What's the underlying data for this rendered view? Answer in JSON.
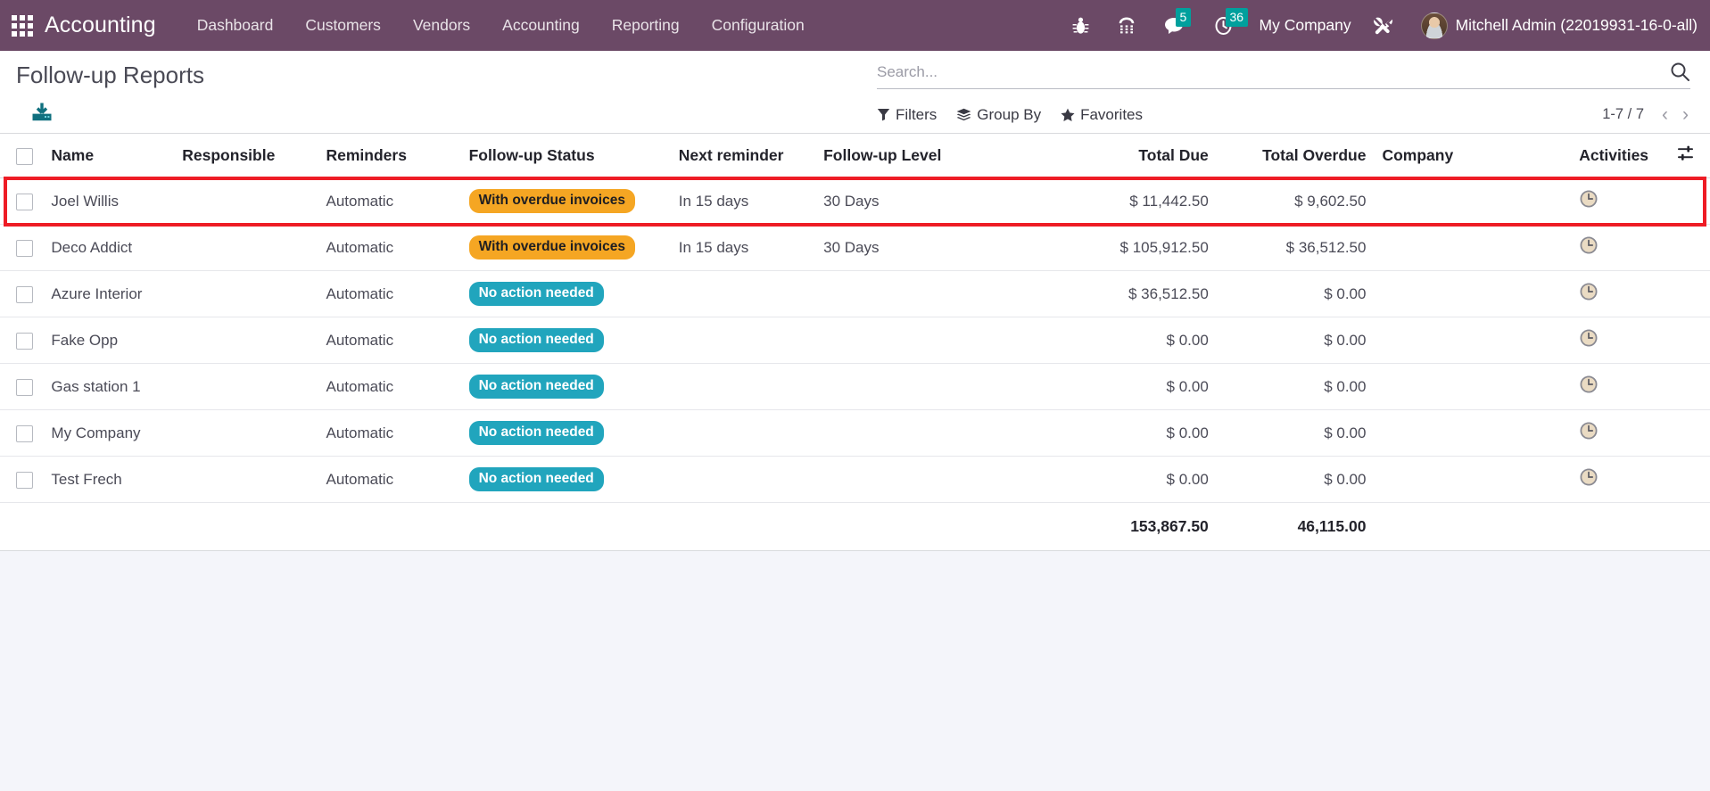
{
  "navbar": {
    "apps_icon": "apps-grid-icon",
    "brand": "Accounting",
    "menu": [
      {
        "label": "Dashboard"
      },
      {
        "label": "Customers"
      },
      {
        "label": "Vendors"
      },
      {
        "label": "Accounting"
      },
      {
        "label": "Reporting"
      },
      {
        "label": "Configuration"
      }
    ],
    "systray": {
      "bug_icon": "bug-icon",
      "phone_icon": "voip-phone-icon",
      "messages_icon": "messages-icon",
      "messages_count": "5",
      "activities_icon": "activities-clock-icon",
      "activities_count": "36",
      "company": "My Company",
      "tools_icon": "debug-tools-icon",
      "avatar": "user-avatar",
      "user": "Mitchell Admin (22019931-16-0-all)"
    }
  },
  "control_panel": {
    "title": "Follow-up Reports",
    "export_icon": "download-export-icon",
    "search": {
      "placeholder": "Search...",
      "value": "",
      "icon": "search-icon"
    },
    "facets": [
      {
        "label": "Filters",
        "icon": "filter-icon"
      },
      {
        "label": "Group By",
        "icon": "group-by-icon"
      },
      {
        "label": "Favorites",
        "icon": "star-icon"
      }
    ],
    "pager": {
      "range": "1-7 / 7",
      "prev": "‹",
      "next": "›"
    }
  },
  "table": {
    "headers": [
      "Name",
      "Responsible",
      "Reminders",
      "Follow-up Status",
      "Next reminder",
      "Follow-up Level",
      "Total Due",
      "Total Overdue",
      "Company",
      "Activities"
    ],
    "options_icon": "column-options-icon",
    "rows": [
      {
        "name": "Joel Willis",
        "responsible": "",
        "reminders": "Automatic",
        "status": "With overdue invoices",
        "status_type": "warning",
        "next_reminder": "In 15 days",
        "level": "30 Days",
        "total_due": "$ 11,442.50",
        "total_overdue": "$ 9,602.50",
        "company": "",
        "activity_icon": "clock-icon",
        "highlighted": true
      },
      {
        "name": "Deco Addict",
        "responsible": "",
        "reminders": "Automatic",
        "status": "With overdue invoices",
        "status_type": "warning",
        "next_reminder": "In 15 days",
        "level": "30 Days",
        "total_due": "$ 105,912.50",
        "total_overdue": "$ 36,512.50",
        "company": "",
        "activity_icon": "clock-icon",
        "highlighted": false
      },
      {
        "name": "Azure Interior",
        "responsible": "",
        "reminders": "Automatic",
        "status": "No action needed",
        "status_type": "info",
        "next_reminder": "",
        "level": "",
        "total_due": "$ 36,512.50",
        "total_overdue": "$ 0.00",
        "company": "",
        "activity_icon": "clock-icon",
        "highlighted": false
      },
      {
        "name": "Fake Opp",
        "responsible": "",
        "reminders": "Automatic",
        "status": "No action needed",
        "status_type": "info",
        "next_reminder": "",
        "level": "",
        "total_due": "$ 0.00",
        "total_overdue": "$ 0.00",
        "company": "",
        "activity_icon": "clock-icon",
        "highlighted": false
      },
      {
        "name": "Gas station 1",
        "responsible": "",
        "reminders": "Automatic",
        "status": "No action needed",
        "status_type": "info",
        "next_reminder": "",
        "level": "",
        "total_due": "$ 0.00",
        "total_overdue": "$ 0.00",
        "company": "",
        "activity_icon": "clock-icon",
        "highlighted": false
      },
      {
        "name": "My Company",
        "responsible": "",
        "reminders": "Automatic",
        "status": "No action needed",
        "status_type": "info",
        "next_reminder": "",
        "level": "",
        "total_due": "$ 0.00",
        "total_overdue": "$ 0.00",
        "company": "",
        "activity_icon": "clock-icon",
        "highlighted": false
      },
      {
        "name": "Test Frech",
        "responsible": "",
        "reminders": "Automatic",
        "status": "No action needed",
        "status_type": "info",
        "next_reminder": "",
        "level": "",
        "total_due": "$ 0.00",
        "total_overdue": "$ 0.00",
        "company": "",
        "activity_icon": "clock-icon",
        "highlighted": false
      }
    ],
    "totals": {
      "total_due": "153,867.50",
      "total_overdue": "46,115.00"
    }
  },
  "colors": {
    "navbar_bg": "#6B4966",
    "accent_teal": "#00A09D",
    "badge_warning": "#F5A623",
    "badge_info": "#21A5BD",
    "highlight_border": "#EE1C25",
    "page_bg": "#F4F5FA"
  }
}
